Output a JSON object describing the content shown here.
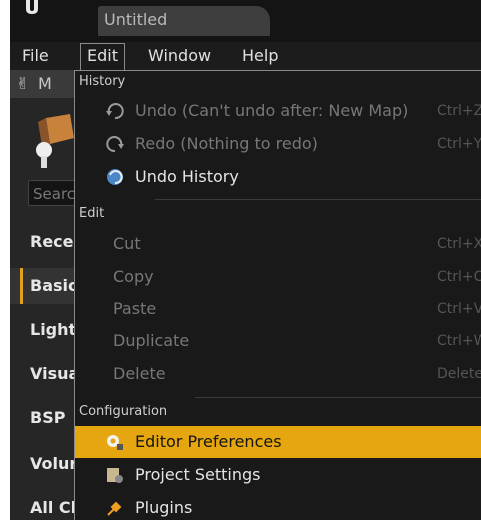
{
  "titlebar": {
    "tab_title": "Untitled"
  },
  "menubar": {
    "items": [
      "File",
      "Edit",
      "Window",
      "Help"
    ]
  },
  "left_panel": {
    "modes_label": "M",
    "search_placeholder": "Searc",
    "categories": [
      "Rece",
      "Basic",
      "Light",
      "Visua",
      "BSP",
      "Volur",
      "All Cl"
    ],
    "selected_category": "Basic"
  },
  "edit_menu": {
    "sections": {
      "history": "History",
      "edit": "Edit",
      "configuration": "Configuration"
    },
    "history_items": [
      {
        "label": "Undo (Can't undo after: New Map)",
        "shortcut": "Ctrl+Z",
        "enabled": false,
        "icon": "undo-icon"
      },
      {
        "label": "Redo (Nothing to redo)",
        "shortcut": "Ctrl+Y",
        "enabled": false,
        "icon": "redo-icon"
      },
      {
        "label": "Undo History",
        "shortcut": "",
        "enabled": true,
        "icon": "undo-history-icon"
      }
    ],
    "edit_items": [
      {
        "label": "Cut",
        "shortcut": "Ctrl+X",
        "enabled": false
      },
      {
        "label": "Copy",
        "shortcut": "Ctrl+C",
        "enabled": false
      },
      {
        "label": "Paste",
        "shortcut": "Ctrl+V",
        "enabled": false
      },
      {
        "label": "Duplicate",
        "shortcut": "Ctrl+W",
        "enabled": false
      },
      {
        "label": "Delete",
        "shortcut": "Delete",
        "enabled": false
      }
    ],
    "configuration_items": [
      {
        "label": "Editor Preferences",
        "highlighted": true,
        "icon": "editor-preferences-icon"
      },
      {
        "label": "Project Settings",
        "highlighted": false,
        "icon": "project-settings-icon"
      },
      {
        "label": "Plugins",
        "highlighted": false,
        "icon": "plugins-icon"
      }
    ]
  },
  "colors": {
    "highlight": "#e5a60f",
    "selected_category_accent": "#e0a020"
  }
}
